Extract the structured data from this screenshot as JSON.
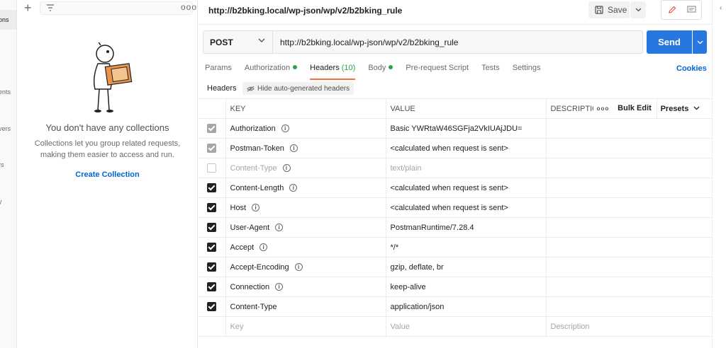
{
  "nav": {
    "items": [
      {
        "label": "ons",
        "active": true
      },
      {
        "label": "ents"
      },
      {
        "label": "vers"
      },
      {
        "label": "rs"
      },
      {
        "label": "y"
      }
    ]
  },
  "sidebar": {
    "more_label": "ooo",
    "empty_title": "You don't have any collections",
    "empty_desc": "Collections let you group related requests, making them easier to access and run.",
    "create_label": "Create Collection"
  },
  "request": {
    "title": "http://b2bking.local/wp-json/wp/v2/b2bking_rule",
    "save_label": "Save",
    "method": "POST",
    "url": "http://b2bking.local/wp-json/wp/v2/b2bking_rule",
    "send_label": "Send"
  },
  "tabs": [
    {
      "label": "Params"
    },
    {
      "label": "Authorization",
      "dot": true
    },
    {
      "label": "Headers",
      "count": "(10)",
      "active": true
    },
    {
      "label": "Body",
      "dot": true
    },
    {
      "label": "Pre-request Script"
    },
    {
      "label": "Tests"
    },
    {
      "label": "Settings"
    }
  ],
  "cookies_label": "Cookies",
  "headers_section": {
    "label": "Headers",
    "hide_auto_label": "Hide auto-generated headers"
  },
  "table": {
    "columns": {
      "key": "KEY",
      "value": "VALUE",
      "description": "DESCRIPTIO",
      "more": "ooo",
      "bulk_edit": "Bulk Edit",
      "presets": "Presets"
    },
    "rows": [
      {
        "key": "Authorization",
        "value": "Basic YWRtaW46SGFja2VkIUAjJDU=",
        "state": "grey",
        "info": true
      },
      {
        "key": "Postman-Token",
        "value": "<calculated when request is sent>",
        "state": "grey",
        "info": true
      },
      {
        "key": "Content-Type",
        "value": "text/plain",
        "state": "off",
        "info": true,
        "muted": true
      },
      {
        "key": "Content-Length",
        "value": "<calculated when request is sent>",
        "state": "on",
        "info": true
      },
      {
        "key": "Host",
        "value": "<calculated when request is sent>",
        "state": "on",
        "info": true
      },
      {
        "key": "User-Agent",
        "value": "PostmanRuntime/7.28.4",
        "state": "on",
        "info": true
      },
      {
        "key": "Accept",
        "value": "*/*",
        "state": "on",
        "info": true
      },
      {
        "key": "Accept-Encoding",
        "value": "gzip, deflate, br",
        "state": "on",
        "info": true
      },
      {
        "key": "Connection",
        "value": "keep-alive",
        "state": "on",
        "info": true
      },
      {
        "key": "Content-Type",
        "value": "application/json",
        "state": "on",
        "info": false
      }
    ],
    "placeholder": {
      "key": "Key",
      "value": "Value",
      "description": "Description"
    }
  },
  "colors": {
    "accent": "#ff6c37",
    "send": "#2678e0",
    "link": "#0265d2",
    "dot": "#2aa34a"
  }
}
